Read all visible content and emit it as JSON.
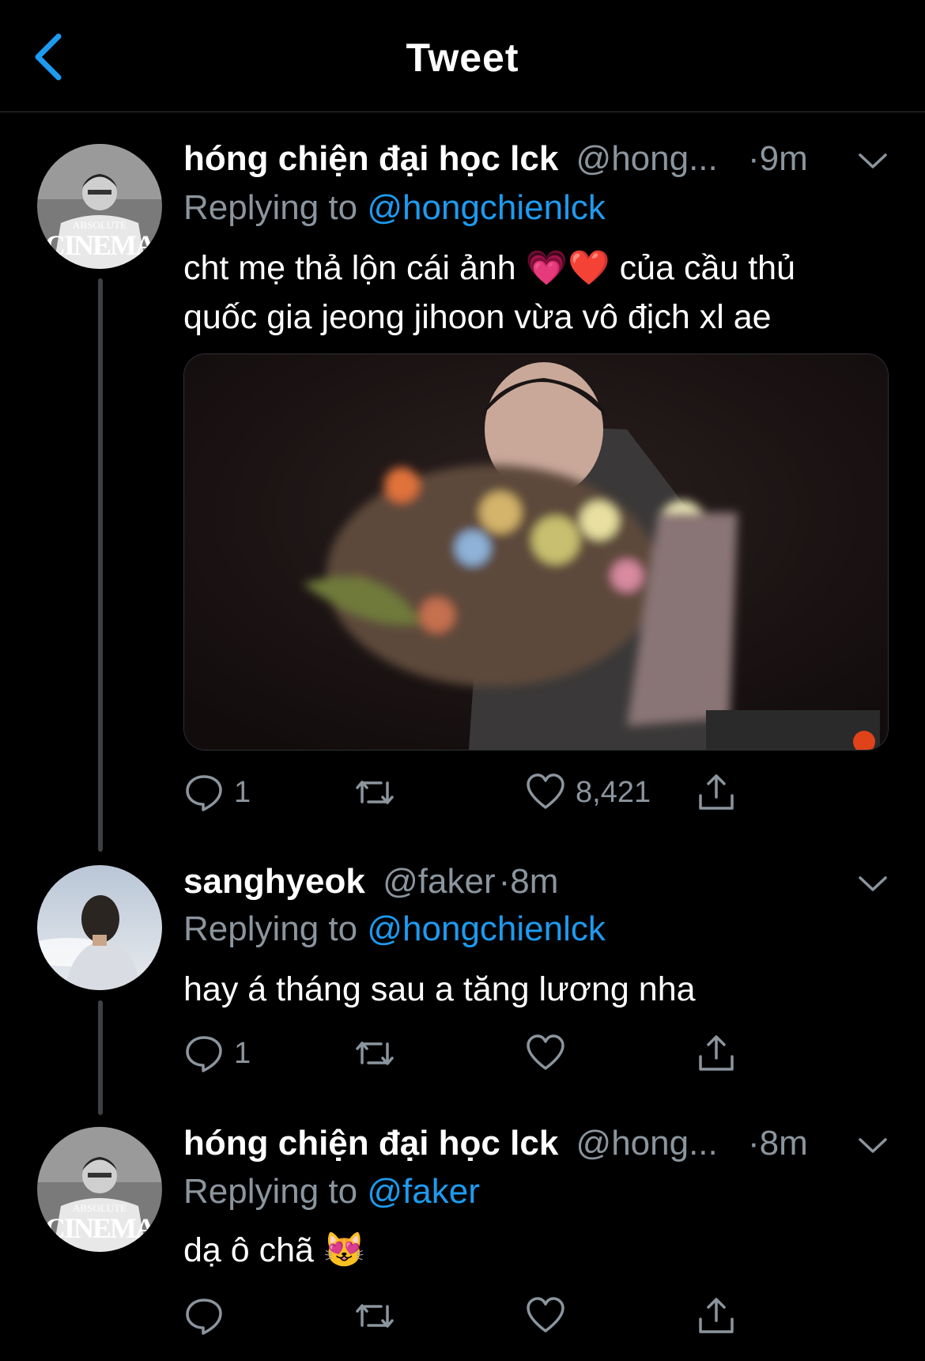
{
  "header": {
    "title": "Tweet"
  },
  "tweets": [
    {
      "name": "hóng chiện đại học lck",
      "handle": "@hong...",
      "time": "·9m",
      "replying_prefix": "Replying to",
      "replying_to": "@hongchienlck",
      "text_line1": "cht mẹ thả lộn cái ảnh 💗❤️ của cầu thủ",
      "text_line2": "quốc gia jeong jihoon vừa vô địch xl ae",
      "avatar_caption_top": "ABSOLUTE",
      "avatar_caption_bottom": "CINEMA",
      "reply_count": "1",
      "like_count": "8,421"
    },
    {
      "name": "sanghyeok",
      "handle": "@faker",
      "time": "·8m",
      "replying_prefix": "Replying to",
      "replying_to": "@hongchienlck",
      "text": "hay á tháng sau a tăng lương nha",
      "reply_count": "1"
    },
    {
      "name": "hóng chiện đại học lck",
      "handle": "@hong...",
      "time": "·8m",
      "replying_prefix": "Replying to",
      "replying_to": "@faker",
      "text": "dạ ô chã 😻",
      "avatar_caption_top": "ABSOLUTE",
      "avatar_caption_bottom": "CINEMA"
    }
  ],
  "icons": {
    "back": "chevron-left-icon",
    "more": "chevron-down-icon",
    "reply": "comment-icon",
    "retweet": "retweet-icon",
    "like": "heart-icon",
    "share": "share-icon"
  },
  "colors": {
    "accent": "#1d9bf0",
    "muted": "#8b959e",
    "background": "#000000"
  }
}
